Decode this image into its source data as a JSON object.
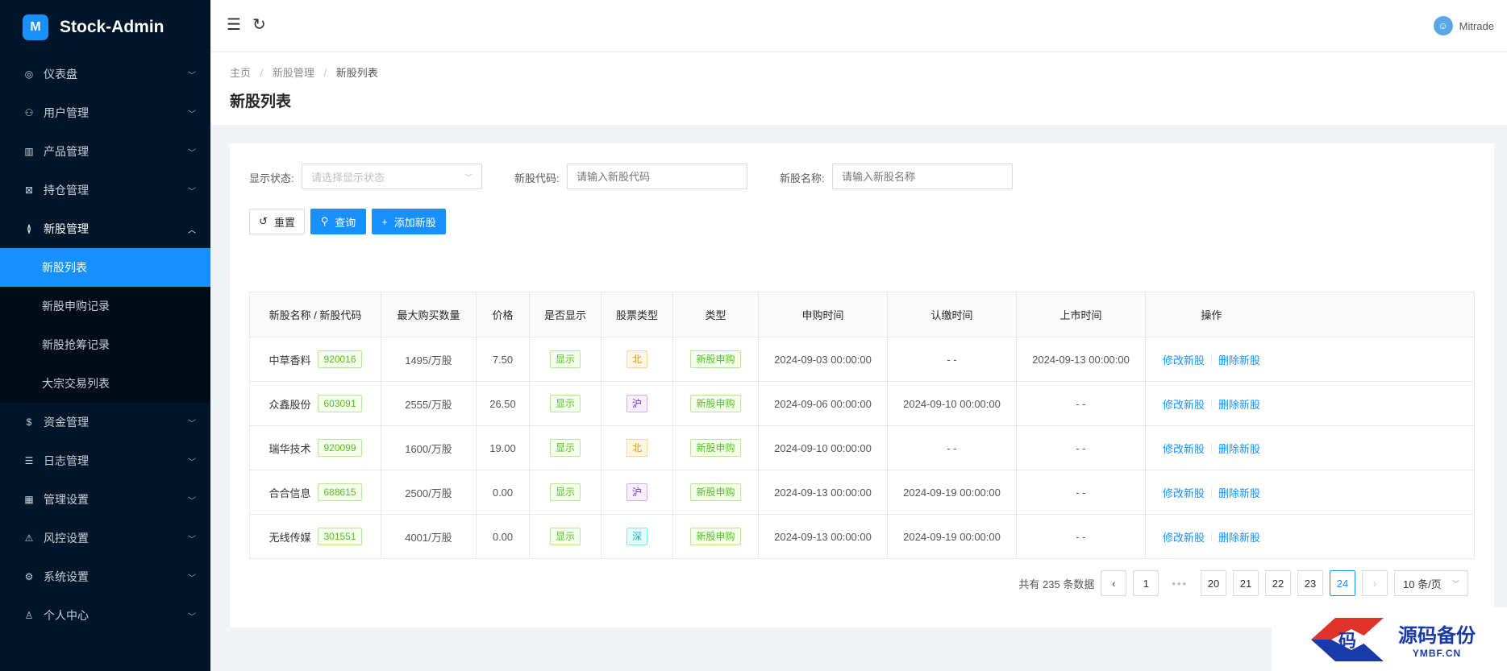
{
  "app": {
    "title": "Stock-Admin",
    "logo_glyph": "M"
  },
  "sidebar": {
    "items": [
      {
        "label": "仪表盘",
        "icon": "dashboard-icon",
        "glyph": "◎"
      },
      {
        "label": "用户管理",
        "icon": "user-manage-icon",
        "glyph": "⚇"
      },
      {
        "label": "产品管理",
        "icon": "chart-icon",
        "glyph": "▥"
      },
      {
        "label": "持仓管理",
        "icon": "position-icon",
        "glyph": "⊠"
      },
      {
        "label": "新股管理",
        "icon": "ipo-icon",
        "glyph": "≬",
        "open": true,
        "children": [
          {
            "label": "新股列表",
            "active": true
          },
          {
            "label": "新股申购记录"
          },
          {
            "label": "新股抢筹记录"
          },
          {
            "label": "大宗交易列表"
          }
        ]
      },
      {
        "label": "资金管理",
        "icon": "money-icon",
        "glyph": "$"
      },
      {
        "label": "日志管理",
        "icon": "log-icon",
        "glyph": "☰"
      },
      {
        "label": "管理设置",
        "icon": "admin-icon",
        "glyph": "▦"
      },
      {
        "label": "风控设置",
        "icon": "warning-icon",
        "glyph": "⚠"
      },
      {
        "label": "系统设置",
        "icon": "gear-icon",
        "glyph": "⚙"
      },
      {
        "label": "个人中心",
        "icon": "person-icon",
        "glyph": "♙"
      }
    ]
  },
  "header": {
    "user_name": "Mitrade"
  },
  "breadcrumb": {
    "home": "主页",
    "parent": "新股管理",
    "current": "新股列表"
  },
  "page": {
    "title": "新股列表"
  },
  "filters": {
    "status_label": "显示状态:",
    "status_placeholder": "请选择显示状态",
    "code_label": "新股代码:",
    "code_placeholder": "请输入新股代码",
    "name_label": "新股名称:",
    "name_placeholder": "请输入新股名称"
  },
  "buttons": {
    "reset": "重置",
    "search": "查询",
    "add": "添加新股"
  },
  "table": {
    "headers": [
      "新股名称 / 新股代码",
      "最大购买数量",
      "价格",
      "是否显示",
      "股票类型",
      "类型",
      "申购时间",
      "认缴时间",
      "上市时间",
      "操作"
    ],
    "rows": [
      {
        "name": "中草香料",
        "code": "920016",
        "max": "1495/万股",
        "price": "7.50",
        "show": "显示",
        "market": "北",
        "market_color": "orange",
        "type": "新股申购",
        "apply": "2024-09-03 00:00:00",
        "pay": "- -",
        "list": "2024-09-13 00:00:00"
      },
      {
        "name": "众鑫股份",
        "code": "603091",
        "max": "2555/万股",
        "price": "26.50",
        "show": "显示",
        "market": "沪",
        "market_color": "purple",
        "type": "新股申购",
        "apply": "2024-09-06 00:00:00",
        "pay": "2024-09-10 00:00:00",
        "list": "- -"
      },
      {
        "name": "瑞华技术",
        "code": "920099",
        "max": "1600/万股",
        "price": "19.00",
        "show": "显示",
        "market": "北",
        "market_color": "orange",
        "type": "新股申购",
        "apply": "2024-09-10 00:00:00",
        "pay": "- -",
        "list": "- -"
      },
      {
        "name": "合合信息",
        "code": "688615",
        "max": "2500/万股",
        "price": "0.00",
        "show": "显示",
        "market": "沪",
        "market_color": "purple",
        "type": "新股申购",
        "apply": "2024-09-13 00:00:00",
        "pay": "2024-09-19 00:00:00",
        "list": "- -"
      },
      {
        "name": "无线传媒",
        "code": "301551",
        "max": "4001/万股",
        "price": "0.00",
        "show": "显示",
        "market": "深",
        "market_color": "cyan",
        "type": "新股申购",
        "apply": "2024-09-13 00:00:00",
        "pay": "2024-09-19 00:00:00",
        "list": "- -"
      }
    ],
    "action_edit": "修改新股",
    "action_delete": "删除新股"
  },
  "pagination": {
    "total_text": "共有 235 条数据",
    "pages": [
      "1",
      "20",
      "21",
      "22",
      "23",
      "24"
    ],
    "current": "24",
    "page_size": "10 条/页"
  },
  "watermark": {
    "glyph": "码",
    "main": "源码备份",
    "sub": "YMBF.CN"
  },
  "colors": {
    "sidebar_bg": "#001529",
    "primary": "#1890ff",
    "submenu_bg": "#000c17"
  }
}
